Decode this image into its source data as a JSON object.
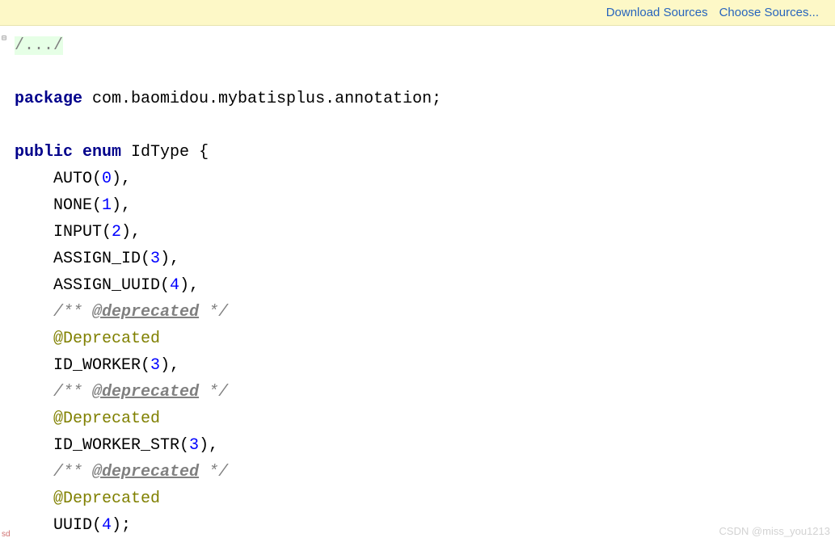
{
  "topbar": {
    "download_sources": "Download Sources",
    "choose_sources": "Choose Sources..."
  },
  "code": {
    "fold_marker": "/.../",
    "package_kw": "package",
    "package_name": " com.baomidou.mybatisplus.annotation;",
    "public_kw": "public",
    "enum_kw": "enum",
    "class_name": " IdType {",
    "auto_name": "AUTO(",
    "auto_val": "0",
    "auto_end": "),",
    "none_name": "NONE(",
    "none_val": "1",
    "none_end": "),",
    "input_name": "INPUT(",
    "input_val": "2",
    "input_end": "),",
    "assignid_name": "ASSIGN_ID(",
    "assignid_val": "3",
    "assignid_end": "),",
    "assignuuid_name": "ASSIGN_UUID(",
    "assignuuid_val": "4",
    "assignuuid_end": "),",
    "dep_comment_pre": "/** ",
    "dep_tag": "@deprecated",
    "dep_comment_post": " */",
    "dep_anno": "@Deprecated",
    "idworker_name": "ID_WORKER(",
    "idworker_val": "3",
    "idworker_end": "),",
    "idworkerstr_name": "ID_WORKER_STR(",
    "idworkerstr_val": "3",
    "idworkerstr_end": "),",
    "uuid_name": "UUID(",
    "uuid_val": "4",
    "uuid_end": ");"
  },
  "indent": "    ",
  "watermark": "CSDN @miss_you1213",
  "sd": "sd"
}
